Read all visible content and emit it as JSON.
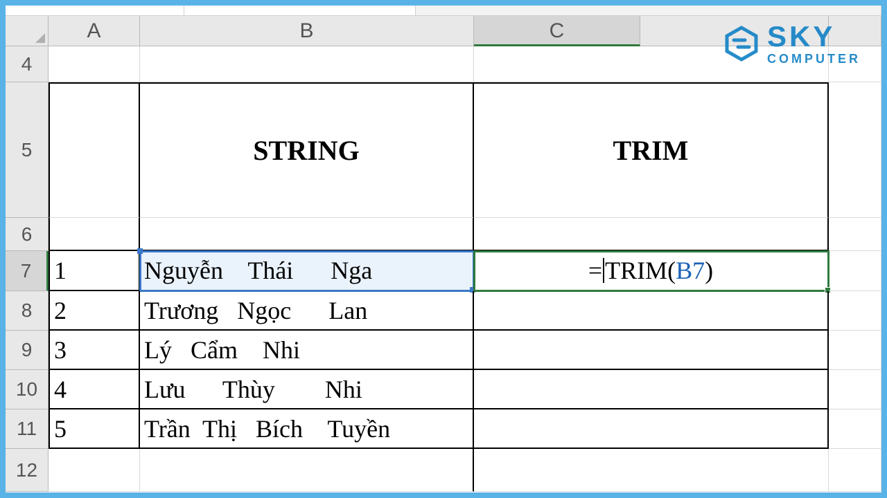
{
  "watermark": {
    "line1": "SKY",
    "line2": "COMPUTER"
  },
  "columns": {
    "A": "A",
    "B": "B",
    "C": "C"
  },
  "col_widths": {
    "A": 132,
    "B": 482,
    "C": 240,
    "c2": 272,
    "D": 90
  },
  "rows": {
    "4": {
      "h": 52
    },
    "5": {
      "h": 196,
      "B": "STRING",
      "C": "TRIM"
    },
    "6": {
      "h": 48
    },
    "7": {
      "h": 58,
      "A": "1",
      "B": "Nguyễn    Thái      Nga",
      "C_pre": "=",
      "C_fn": "TRIM(",
      "C_ref": "B7",
      "C_post": ")"
    },
    "8": {
      "h": 57,
      "A": "2",
      "B": "Trương   Ngọc      Lan"
    },
    "9": {
      "h": 57,
      "A": "3",
      "B": "Lý   Cẩm    Nhi"
    },
    "10": {
      "h": 57,
      "A": "4",
      "B": "Lưu      Thùy        Nhi"
    },
    "11": {
      "h": 57,
      "A": "5",
      "B": "Trần  Thị   Bích    Tuyền"
    },
    "12": {
      "h": 62
    }
  },
  "row_labels": {
    "4": "4",
    "5": "5",
    "6": "6",
    "7": "7",
    "8": "8",
    "9": "9",
    "10": "10",
    "11": "11",
    "12": "12"
  },
  "active_cell": "C7",
  "referenced_cell": "B7"
}
